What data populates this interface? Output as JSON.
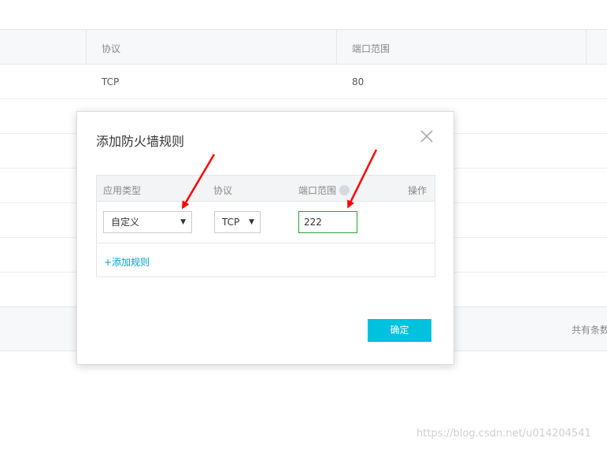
{
  "background_table": {
    "columns": [
      "协议",
      "端口范围"
    ],
    "rows": [
      {
        "protocol": "TCP",
        "port": "80"
      }
    ],
    "footer_text": "共有条数"
  },
  "dialog": {
    "title": "添加防火墙规则",
    "close_icon": "close-icon",
    "columns": {
      "app_type": "应用类型",
      "protocol": "协议",
      "port_range": "端口范围",
      "action": "操作"
    },
    "rule": {
      "app_type_value": "自定义",
      "protocol_value": "TCP",
      "port_value": "222"
    },
    "caret": "▼",
    "add_rule_label": "+添加规则",
    "confirm_label": "确定"
  },
  "annotation": {
    "arrow_color": "#ff0000"
  },
  "colors": {
    "accent": "#00c1de",
    "link": "#00a2c9",
    "input_focus_border": "#2a9d3a"
  },
  "watermark": "https://blog.csdn.net/u014204541"
}
